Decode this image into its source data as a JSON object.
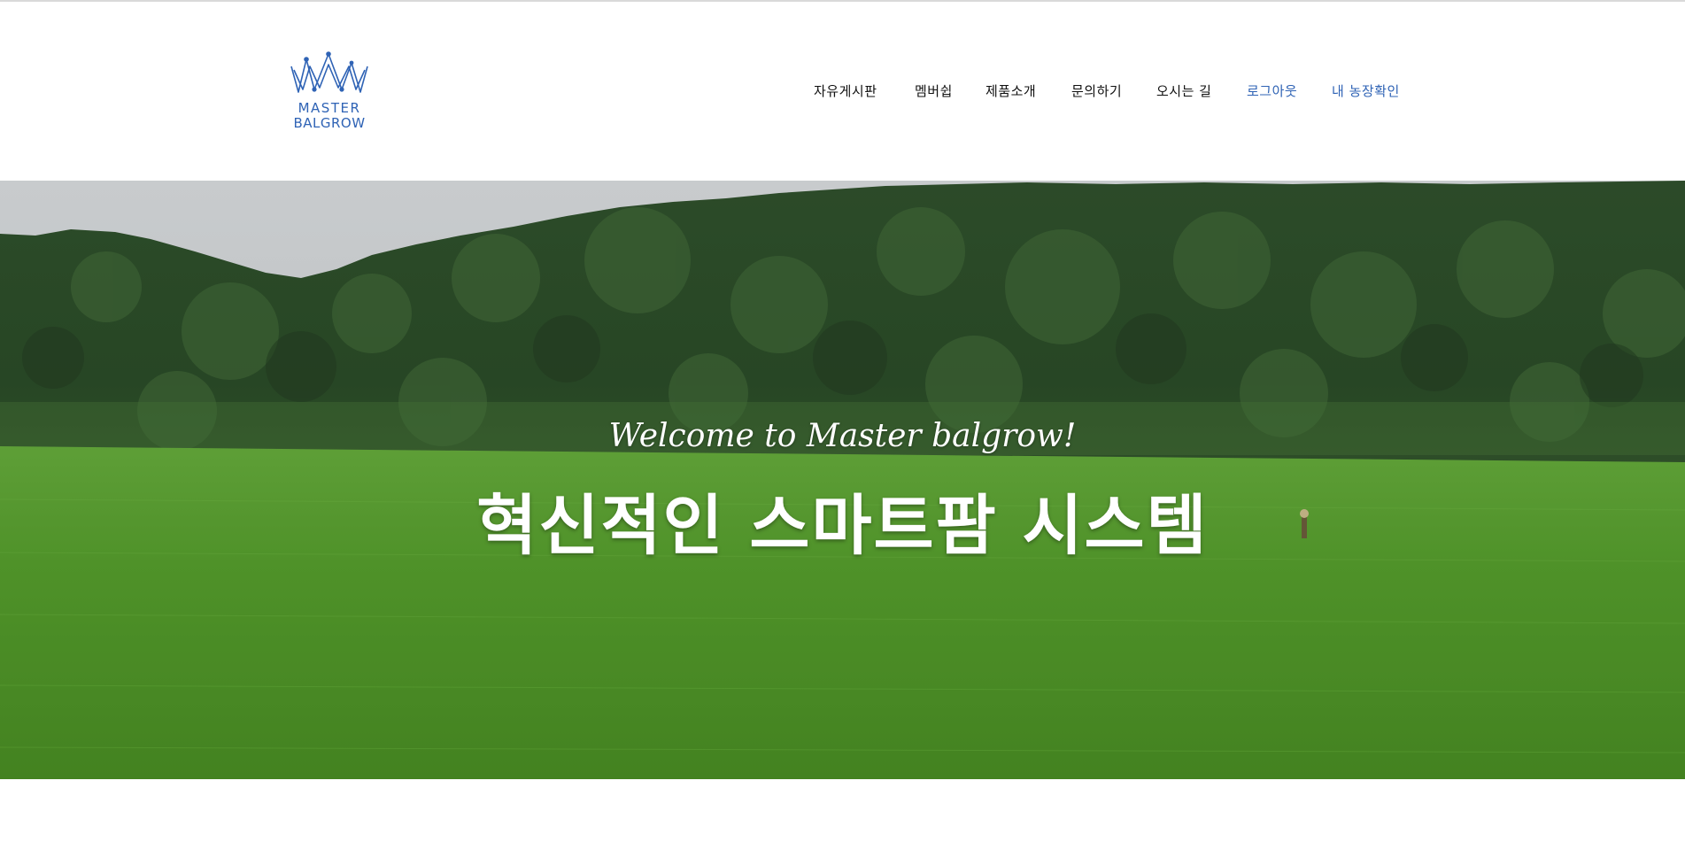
{
  "logo": {
    "line1": "MASTER",
    "line2": "BALGROW",
    "icon": "crown-icon",
    "color": "#2f63b5"
  },
  "nav": {
    "items": [
      {
        "label": "자유게시판"
      },
      {
        "label": "멤버쉽"
      },
      {
        "label": "제품소개"
      },
      {
        "label": "문의하기"
      },
      {
        "label": "오시는 길"
      },
      {
        "label": "로그아웃",
        "accent": true
      },
      {
        "label": "내 농장확인",
        "accent": true
      }
    ],
    "accent_color": "#2f63b5"
  },
  "hero": {
    "welcome": "Welcome to Master balgrow!",
    "title": "혁신적인 스마트팜 시스템"
  }
}
